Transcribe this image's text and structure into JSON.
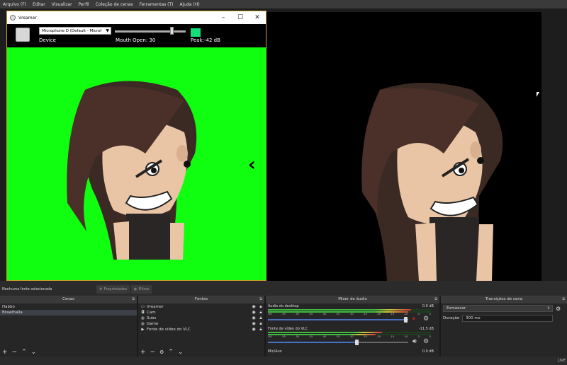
{
  "menu": [
    "Arquivo (F)",
    "Editar",
    "Visualizar",
    "Perfil",
    "Coleção de cenas",
    "Ferramentas (T)",
    "Ajuda (H)"
  ],
  "vreamer": {
    "title": "Vreamer",
    "device_value": "Microphone D (Default - Microf",
    "device_label": "Device",
    "mouth_label": "Mouth Open: 30",
    "peak_label": "Peak:-42 dB",
    "mouth_open": 30,
    "colors": {
      "chroma": "#10ff10",
      "peak": "#14e07a"
    }
  },
  "status": {
    "no_source": "Nenhuma fonte selecionada",
    "properties": "Propriedades",
    "filters": "Filtros"
  },
  "scenes": {
    "title": "Cenas",
    "items": [
      "Habbo",
      "Brawlhalla"
    ]
  },
  "sources": {
    "title": "Fontes",
    "items": [
      {
        "name": "Vreamer",
        "icon": "window-icon"
      },
      {
        "name": "Cam",
        "icon": "camera-icon"
      },
      {
        "name": "Subs",
        "icon": "globe-icon"
      },
      {
        "name": "Game",
        "icon": "globe-icon"
      },
      {
        "name": "Fonte de vídeo do VLC",
        "icon": "play-icon"
      }
    ]
  },
  "mixer": {
    "title": "Mixer de áudio",
    "channels": [
      {
        "name": "Áudio do desktop",
        "db": "0.0 dB",
        "volume": 0.98,
        "muted": true
      },
      {
        "name": "Fonte de vídeo do VLC",
        "db": "-11.5 dB",
        "volume": 0.63,
        "muted": false
      },
      {
        "name": "Mic/Aux",
        "db": "0.0 dB"
      }
    ],
    "ticks": [
      "-60",
      "-55",
      "-50",
      "-45",
      "-40",
      "-35",
      "-30",
      "-25",
      "-20",
      "-15",
      "-10",
      "-5",
      "0"
    ]
  },
  "transitions": {
    "title": "Transições de cena",
    "selected": "Esmaecer",
    "duration_label": "Duração",
    "duration_value": "300 ms"
  },
  "footer": {
    "live": "LIVE"
  }
}
